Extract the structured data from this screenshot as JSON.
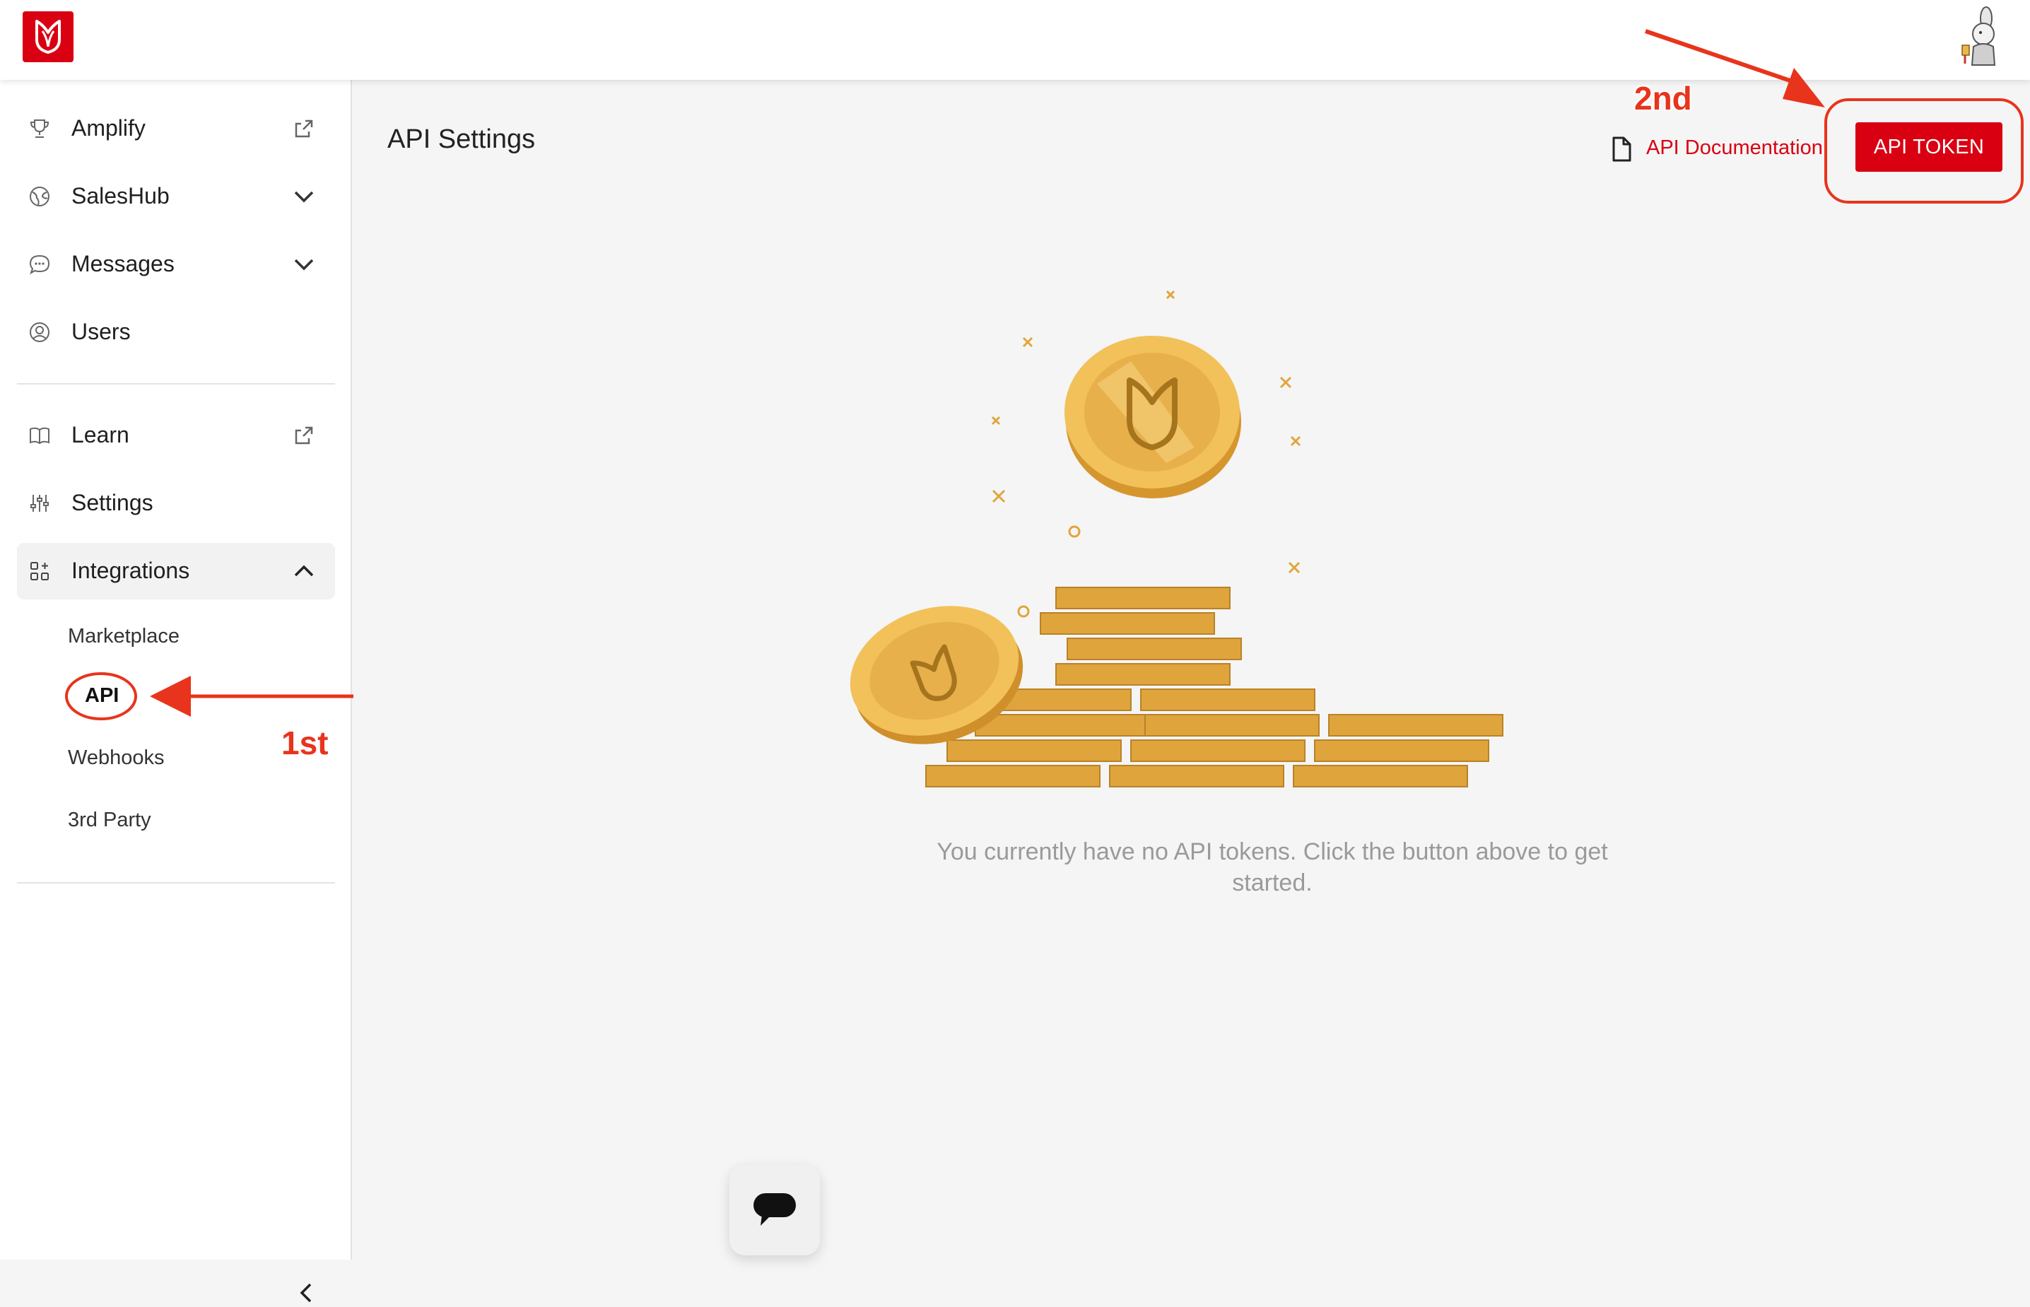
{
  "sidebar": {
    "items": [
      {
        "label": "Amplify",
        "icon": "trophy-icon",
        "right_icon": "external-link-icon"
      },
      {
        "label": "SalesHub",
        "icon": "globe-icon",
        "right_icon": "chevron-down-icon"
      },
      {
        "label": "Messages",
        "icon": "chat-bubble-icon",
        "right_icon": "chevron-down-icon"
      },
      {
        "label": "Users",
        "icon": "user-circle-icon"
      },
      {
        "label": "Learn",
        "icon": "book-icon",
        "right_icon": "external-link-icon"
      },
      {
        "label": "Settings",
        "icon": "sliders-icon"
      },
      {
        "label": "Integrations",
        "icon": "grid-plus-icon",
        "right_icon": "chevron-up-icon",
        "active": true
      }
    ],
    "integrations_subitems": [
      {
        "label": "Marketplace"
      },
      {
        "label": "API",
        "active": true
      },
      {
        "label": "Webhooks"
      },
      {
        "label": "3rd Party"
      }
    ]
  },
  "main": {
    "title": "API Settings",
    "doc_link": "API Documentation",
    "api_token_button": "API TOKEN",
    "empty_message": "You currently have no API tokens. Click the button above to get started."
  },
  "annotations": {
    "first": "1st",
    "second": "2nd"
  },
  "colors": {
    "brand_red": "#d90012",
    "annotation_red": "#e8341c",
    "coin_gold": "#e9b84c"
  }
}
